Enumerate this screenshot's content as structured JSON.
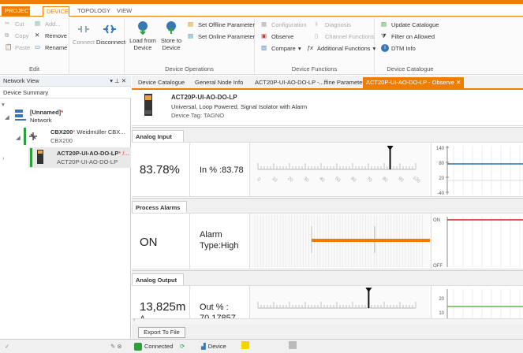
{
  "tabs": {
    "project": "PROJECT",
    "device": "DEVICE",
    "topology": "TOPOLOGY",
    "view": "VIEW"
  },
  "ribbon": {
    "edit": {
      "cut": "Cut",
      "copy": "Copy",
      "paste": "Paste",
      "add": "Add...",
      "remove": "Remove",
      "rename": "Rename",
      "label": "Edit"
    },
    "connect": {
      "connect": "Connect",
      "disconnect": "Disconnect"
    },
    "ops": {
      "load_from_device": "Load from Device",
      "store_to_device": "Store to Device",
      "set_offline": "Set Offline Parameter",
      "set_online": "Set Online Parameter",
      "label": "Device Operations"
    },
    "functions": {
      "configuration": "Configuration",
      "diagnosis": "Diagnosis",
      "observe": "Observe",
      "channel_functions": "Channel Functions",
      "compare": "Compare",
      "additional": "Additional Functions",
      "label": "Device Functions"
    },
    "catalogue": {
      "update": "Update Catalogue",
      "filter": "Filter on Allowed",
      "dtm_info": "DTM Info",
      "label": "Device Catalogue"
    }
  },
  "network_view": {
    "title": "Network View",
    "pin": "▾ p ✕",
    "summary": "Device Summary",
    "tree": [
      {
        "name": "[Unnamed]",
        "marker": "*",
        "sub": "Network"
      },
      {
        "name": "CBX200",
        "marker": "*",
        "vendor": "Weidmüller CBX...",
        "sub": "CBX200"
      },
      {
        "name": "ACT20P-UI-AO-DO-LP",
        "marker": "* /...",
        "sub": "ACT20P-UI-AO-DO-LP"
      }
    ]
  },
  "doc_tabs": [
    "Device Catalogue",
    "General Node Info",
    "ACT20P-UI-AO-DO-LP -...ffine Parameter",
    "ACT20P-UI-AO-DO-LP - Observe"
  ],
  "device": {
    "name": "ACT20P-UI-AO-DO-LP",
    "description": "Universal, Loop Powered, Signal Isolator with Alarm",
    "tag_label": "Device Tag:",
    "tag": "TAGNO"
  },
  "analog_input": {
    "title": "Analog Input",
    "value": "83.78%",
    "label": "In % :83.78",
    "level": 83.78,
    "ticks": [
      "0",
      "10",
      "20",
      "30",
      "40",
      "50",
      "60",
      "70",
      "80",
      "90",
      "100"
    ],
    "trend_ticks": [
      "140",
      "80",
      "20",
      "-40"
    ]
  },
  "process_alarms": {
    "title": "Process Alarms",
    "value": "ON",
    "label": "Alarm Type:High",
    "trend_ticks": [
      "ON",
      "OFF"
    ]
  },
  "analog_output": {
    "title": "Analog Output",
    "value": "13,825m",
    "value2": "A",
    "label": "Out % :",
    "label2": "70.17857",
    "trend_ticks": [
      "20",
      "10"
    ]
  },
  "export_button": "Export To File",
  "status": {
    "connected": "Connected",
    "device": "Device"
  },
  "colors": {
    "accent": "#ef7d00",
    "alarm_line": "#d9261c",
    "trend_blue": "#2f6db5",
    "trend_green": "#6ab04c"
  }
}
